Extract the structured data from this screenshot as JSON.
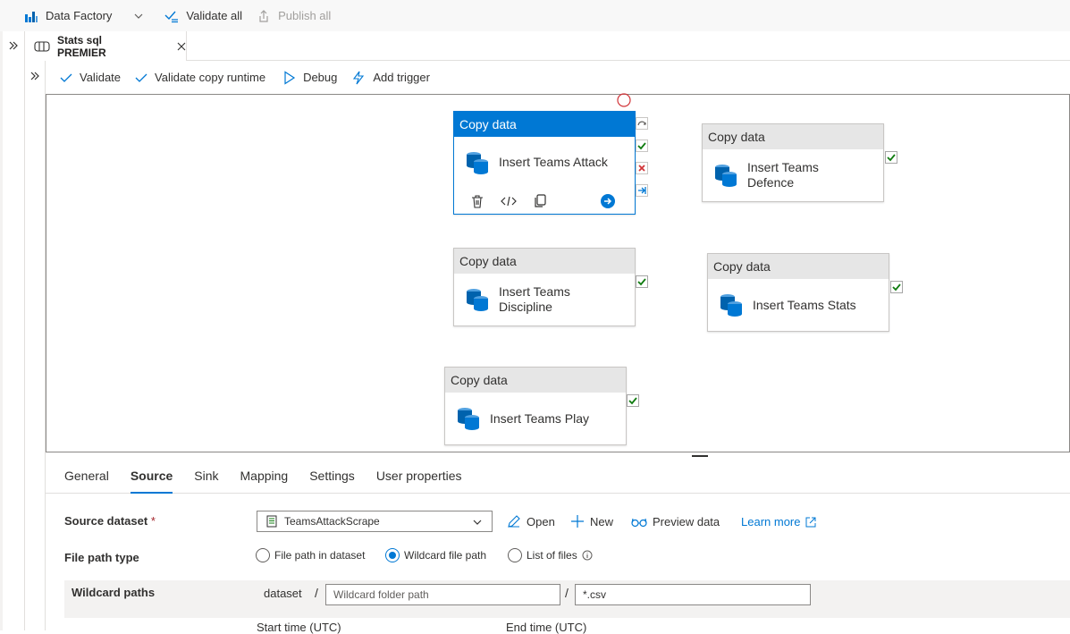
{
  "topbar": {
    "factory_label": "Data Factory",
    "validate_all": "Validate all",
    "publish_all": "Publish all"
  },
  "tab": {
    "title": "Stats sql PREMIER"
  },
  "toolbar": {
    "validate": "Validate",
    "validate_copy_runtime": "Validate copy runtime",
    "debug": "Debug",
    "add_trigger": "Add trigger"
  },
  "activities": [
    {
      "type": "Copy data",
      "name": "Insert Teams Attack",
      "selected": true
    },
    {
      "type": "Copy data",
      "name": "Insert Teams Defence"
    },
    {
      "type": "Copy data",
      "name": "Insert Teams Discipline"
    },
    {
      "type": "Copy data",
      "name": "Insert Teams Stats"
    },
    {
      "type": "Copy data",
      "name": "Insert Teams Play"
    }
  ],
  "panel_tabs": [
    "General",
    "Source",
    "Sink",
    "Mapping",
    "Settings",
    "User properties"
  ],
  "active_tab": "Source",
  "source": {
    "dataset_label": "Source dataset",
    "required_mark": "*",
    "dataset_value": "TeamsAttackScrape",
    "open": "Open",
    "new": "New",
    "preview": "Preview data",
    "learn_more": "Learn more",
    "file_path_type_label": "File path type",
    "radio_options": [
      "File path in dataset",
      "Wildcard file path",
      "List of files"
    ],
    "radio_selected": "Wildcard file path",
    "wildcard_label": "Wildcard paths",
    "wildcard_prefix": "dataset",
    "folder_placeholder": "Wildcard folder path",
    "file_value": "*.csv",
    "start_time": "Start time (UTC)",
    "end_time": "End time (UTC)"
  },
  "colors": {
    "accent": "#0078d4",
    "success": "#107c10",
    "failure": "#d13438"
  }
}
